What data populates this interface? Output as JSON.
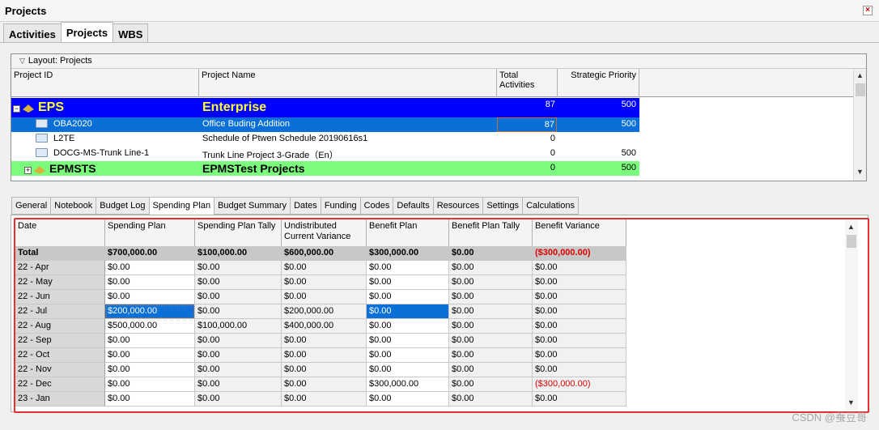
{
  "window": {
    "title": "Projects",
    "close_label": "×"
  },
  "main_tabs": [
    {
      "label": "Activities",
      "active": false
    },
    {
      "label": "Projects",
      "active": true
    },
    {
      "label": "WBS",
      "active": false
    }
  ],
  "layout_label": "Layout: Projects",
  "project_columns": [
    "Project ID",
    "Project Name",
    "Total Activities",
    "Strategic Priority"
  ],
  "project_rows": [
    {
      "id": "EPS",
      "name": "Enterprise",
      "total_activities": "87",
      "priority": "500",
      "kind": "eps-expanded"
    },
    {
      "id": "OBA2020",
      "name": "Office Buding Addition",
      "total_activities": "87",
      "priority": "500",
      "kind": "selected"
    },
    {
      "id": "L2TE",
      "name": "Schedule of Ptwen Schedule 20190616s1",
      "total_activities": "0",
      "priority": "",
      "kind": "project"
    },
    {
      "id": "DOCG-MS-Trunk Line-1",
      "name": "Trunk Line Project 3-Grade（En）",
      "total_activities": "0",
      "priority": "500",
      "kind": "project"
    },
    {
      "id": "EPMSTS",
      "name": "EPMSTest Projects",
      "total_activities": "0",
      "priority": "500",
      "kind": "eps-collapsed"
    }
  ],
  "detail_tabs": [
    {
      "label": "General",
      "active": false
    },
    {
      "label": "Notebook",
      "active": false
    },
    {
      "label": "Budget Log",
      "active": false
    },
    {
      "label": "Spending Plan",
      "active": true
    },
    {
      "label": "Budget Summary",
      "active": false
    },
    {
      "label": "Dates",
      "active": false
    },
    {
      "label": "Funding",
      "active": false
    },
    {
      "label": "Codes",
      "active": false
    },
    {
      "label": "Defaults",
      "active": false
    },
    {
      "label": "Resources",
      "active": false
    },
    {
      "label": "Settings",
      "active": false
    },
    {
      "label": "Calculations",
      "active": false
    }
  ],
  "spending_columns": [
    "Date",
    "Spending Plan",
    "Spending Plan Tally",
    "Undistributed\nCurrent Variance",
    "Benefit Plan",
    "Benefit Plan Tally",
    "Benefit Variance"
  ],
  "spending_total": [
    "Total",
    "$700,000.00",
    "$100,000.00",
    "$600,000.00",
    "$300,000.00",
    "$0.00",
    "($300,000.00)"
  ],
  "spending_rows": [
    [
      "22 - Apr",
      "$0.00",
      "$0.00",
      "$0.00",
      "$0.00",
      "$0.00",
      "$0.00"
    ],
    [
      "22 - May",
      "$0.00",
      "$0.00",
      "$0.00",
      "$0.00",
      "$0.00",
      "$0.00"
    ],
    [
      "22 - Jun",
      "$0.00",
      "$0.00",
      "$0.00",
      "$0.00",
      "$0.00",
      "$0.00"
    ],
    [
      "22 - Jul",
      "$200,000.00",
      "$0.00",
      "$200,000.00",
      "$0.00",
      "$0.00",
      "$0.00"
    ],
    [
      "22 - Aug",
      "$500,000.00",
      "$100,000.00",
      "$400,000.00",
      "$0.00",
      "$0.00",
      "$0.00"
    ],
    [
      "22 - Sep",
      "$0.00",
      "$0.00",
      "$0.00",
      "$0.00",
      "$0.00",
      "$0.00"
    ],
    [
      "22 - Oct",
      "$0.00",
      "$0.00",
      "$0.00",
      "$0.00",
      "$0.00",
      "$0.00"
    ],
    [
      "22 - Nov",
      "$0.00",
      "$0.00",
      "$0.00",
      "$0.00",
      "$0.00",
      "$0.00"
    ],
    [
      "22 - Dec",
      "$0.00",
      "$0.00",
      "$0.00",
      "$300,000.00",
      "$0.00",
      "($300,000.00)"
    ],
    [
      "23 - Jan",
      "$0.00",
      "$0.00",
      "$0.00",
      "$0.00",
      "$0.00",
      "$0.00"
    ]
  ],
  "watermark": "CSDN @蚕豆哥",
  "colors": {
    "eps_row": "#0000ff",
    "eps_text": "#ffff33",
    "selected_row": "#0a6fd6",
    "green_row": "#7cfc7c",
    "negative": "#e00000",
    "highlight_box": "#e53030"
  }
}
